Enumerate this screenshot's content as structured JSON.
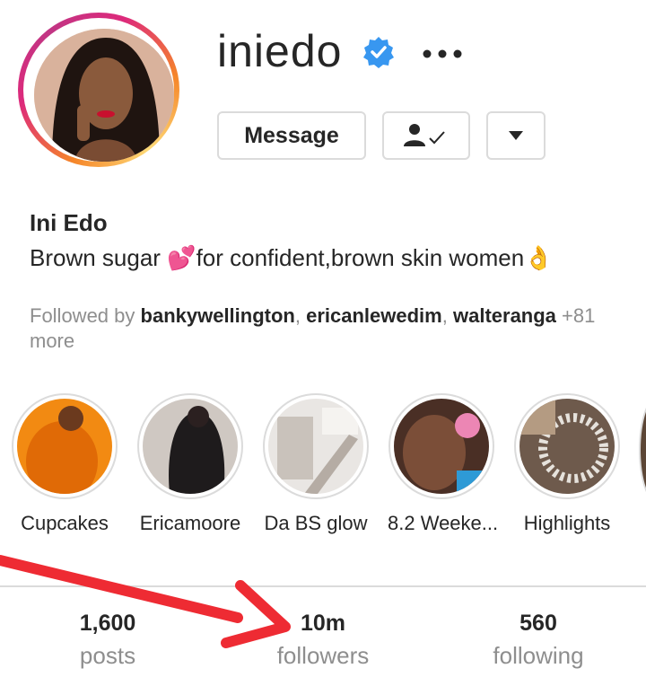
{
  "profile": {
    "username": "iniedo",
    "verified": true,
    "full_name": "Ini Edo",
    "bio_before": "Brown sugar ",
    "bio_emoji_heart": "💕",
    "bio_after": "for confident,brown skin women",
    "bio_emoji_ok": "👌",
    "followed_by_prefix": "Followed by ",
    "followed_by_users": [
      "bankywellington",
      "ericanlewedim",
      "walteranga"
    ],
    "followed_by_suffix": "+81 more"
  },
  "actions": {
    "message_label": "Message",
    "more_icon": "more-horizontal-icon",
    "following_icon": "person-check-icon",
    "dropdown_icon": "triangle-down-icon"
  },
  "highlights": [
    {
      "label": "Cupcakes"
    },
    {
      "label": "Ericamoore"
    },
    {
      "label": "Da BS glow"
    },
    {
      "label": "8.2 Weeke..."
    },
    {
      "label": "Highlights"
    }
  ],
  "stats": {
    "posts_count": "1,600",
    "posts_label": "posts",
    "followers_count": "10m",
    "followers_label": "followers",
    "following_count": "560",
    "following_label": "following"
  },
  "colors": {
    "annotation_arrow": "#ee2b33",
    "verified_badge": "#3897f0"
  }
}
